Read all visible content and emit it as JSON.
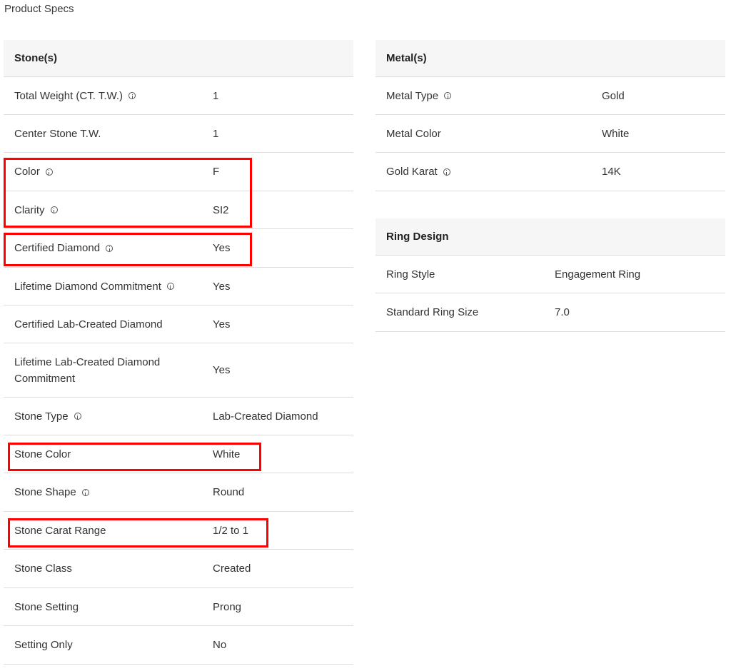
{
  "page": {
    "title": "Product Specs"
  },
  "stones": {
    "header": "Stone(s)",
    "rows": [
      {
        "label": "Total Weight (CT. T.W.)",
        "value": "1",
        "info": true
      },
      {
        "label": "Center Stone T.W.",
        "value": "1",
        "info": false
      },
      {
        "label": "Color",
        "value": "F",
        "info": true
      },
      {
        "label": "Clarity",
        "value": "SI2",
        "info": true
      },
      {
        "label": "Certified Diamond",
        "value": "Yes",
        "info": true
      },
      {
        "label": "Lifetime Diamond Commitment",
        "value": "Yes",
        "info": true
      },
      {
        "label": "Certified Lab-Created Diamond",
        "value": "Yes",
        "info": false
      },
      {
        "label": "Lifetime Lab-Created Diamond Commitment",
        "value": "Yes",
        "info": false
      },
      {
        "label": "Stone Type",
        "value": "Lab-Created Diamond",
        "info": true
      },
      {
        "label": "Stone Color",
        "value": "White",
        "info": false
      },
      {
        "label": "Stone Shape",
        "value": "Round",
        "info": true
      },
      {
        "label": "Stone Carat Range",
        "value": "1/2 to 1",
        "info": false
      },
      {
        "label": "Stone Class",
        "value": "Created",
        "info": false
      },
      {
        "label": "Stone Setting",
        "value": "Prong",
        "info": false
      },
      {
        "label": "Setting Only",
        "value": "No",
        "info": false
      }
    ]
  },
  "metals": {
    "header": "Metal(s)",
    "rows": [
      {
        "label": "Metal Type",
        "value": "Gold",
        "info": true
      },
      {
        "label": "Metal Color",
        "value": "White",
        "info": false
      },
      {
        "label": "Gold Karat",
        "value": "14K",
        "info": true
      }
    ]
  },
  "ring": {
    "header": "Ring Design",
    "rows": [
      {
        "label": "Ring Style",
        "value": "Engagement Ring",
        "info": false
      },
      {
        "label": "Standard Ring Size",
        "value": "7.0",
        "info": false
      }
    ]
  },
  "colors": {
    "header_bg": "#f6f6f6",
    "divider": "#dddddd",
    "highlight": "#ff0000"
  }
}
